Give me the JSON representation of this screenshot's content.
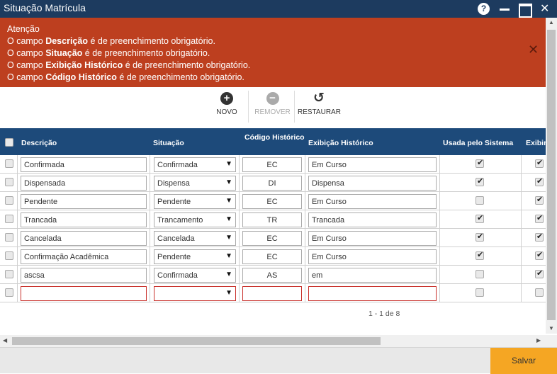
{
  "window": {
    "title": "Situação Matrícula",
    "help_label": "?",
    "close_label": "✕"
  },
  "alert": {
    "heading": "Atenção",
    "prefix": "O campo",
    "suffix": "é de preenchimento obrigatório.",
    "fields": [
      "Descrição",
      "Situação",
      "Exibição Histórico",
      "Código Histórico"
    ],
    "close_label": "✕"
  },
  "toolbar": {
    "novo_label": "NOVO",
    "remover_label": "REMOVER",
    "restaurar_label": "RESTAURAR"
  },
  "grid": {
    "headers": {
      "descricao": "Descrição",
      "situacao": "Situação",
      "codigo": "Código Histórico",
      "exibicao": "Exibição Histórico",
      "usada": "Usada pelo Sistema",
      "exibir": "Exibir"
    },
    "rows": [
      {
        "descricao": "Confirmada",
        "situacao": "Confirmada",
        "codigo": "EC",
        "exibicao": "Em Curso",
        "usada": true,
        "exibir": true
      },
      {
        "descricao": "Dispensada",
        "situacao": "Dispensa",
        "codigo": "DI",
        "exibicao": "Dispensa",
        "usada": true,
        "exibir": true
      },
      {
        "descricao": "Pendente",
        "situacao": "Pendente",
        "codigo": "EC",
        "exibicao": "Em Curso",
        "usada": false,
        "exibir": true
      },
      {
        "descricao": "Trancada",
        "situacao": "Trancamento",
        "codigo": "TR",
        "exibicao": "Trancada",
        "usada": true,
        "exibir": true
      },
      {
        "descricao": "Cancelada",
        "situacao": "Cancelada",
        "codigo": "EC",
        "exibicao": "Em Curso",
        "usada": true,
        "exibir": true
      },
      {
        "descricao": "Confirmação Acadêmica",
        "situacao": "Pendente",
        "codigo": "EC",
        "exibicao": "Em Curso",
        "usada": true,
        "exibir": true
      },
      {
        "descricao": "ascsa",
        "situacao": "Confirmada",
        "codigo": "AS",
        "exibicao": "em",
        "usada": false,
        "exibir": true
      },
      {
        "descricao": "",
        "situacao": "",
        "codigo": "",
        "exibicao": "",
        "usada": false,
        "exibir": false
      }
    ],
    "pager": "1 - 1 de 8"
  },
  "footer": {
    "save_label": "Salvar"
  },
  "colors": {
    "titlebar": "#1d3b5f",
    "alert": "#bd3f1f",
    "header": "#1d4a7a",
    "save_button": "#f5a623",
    "invalid_border": "#c8302b"
  }
}
